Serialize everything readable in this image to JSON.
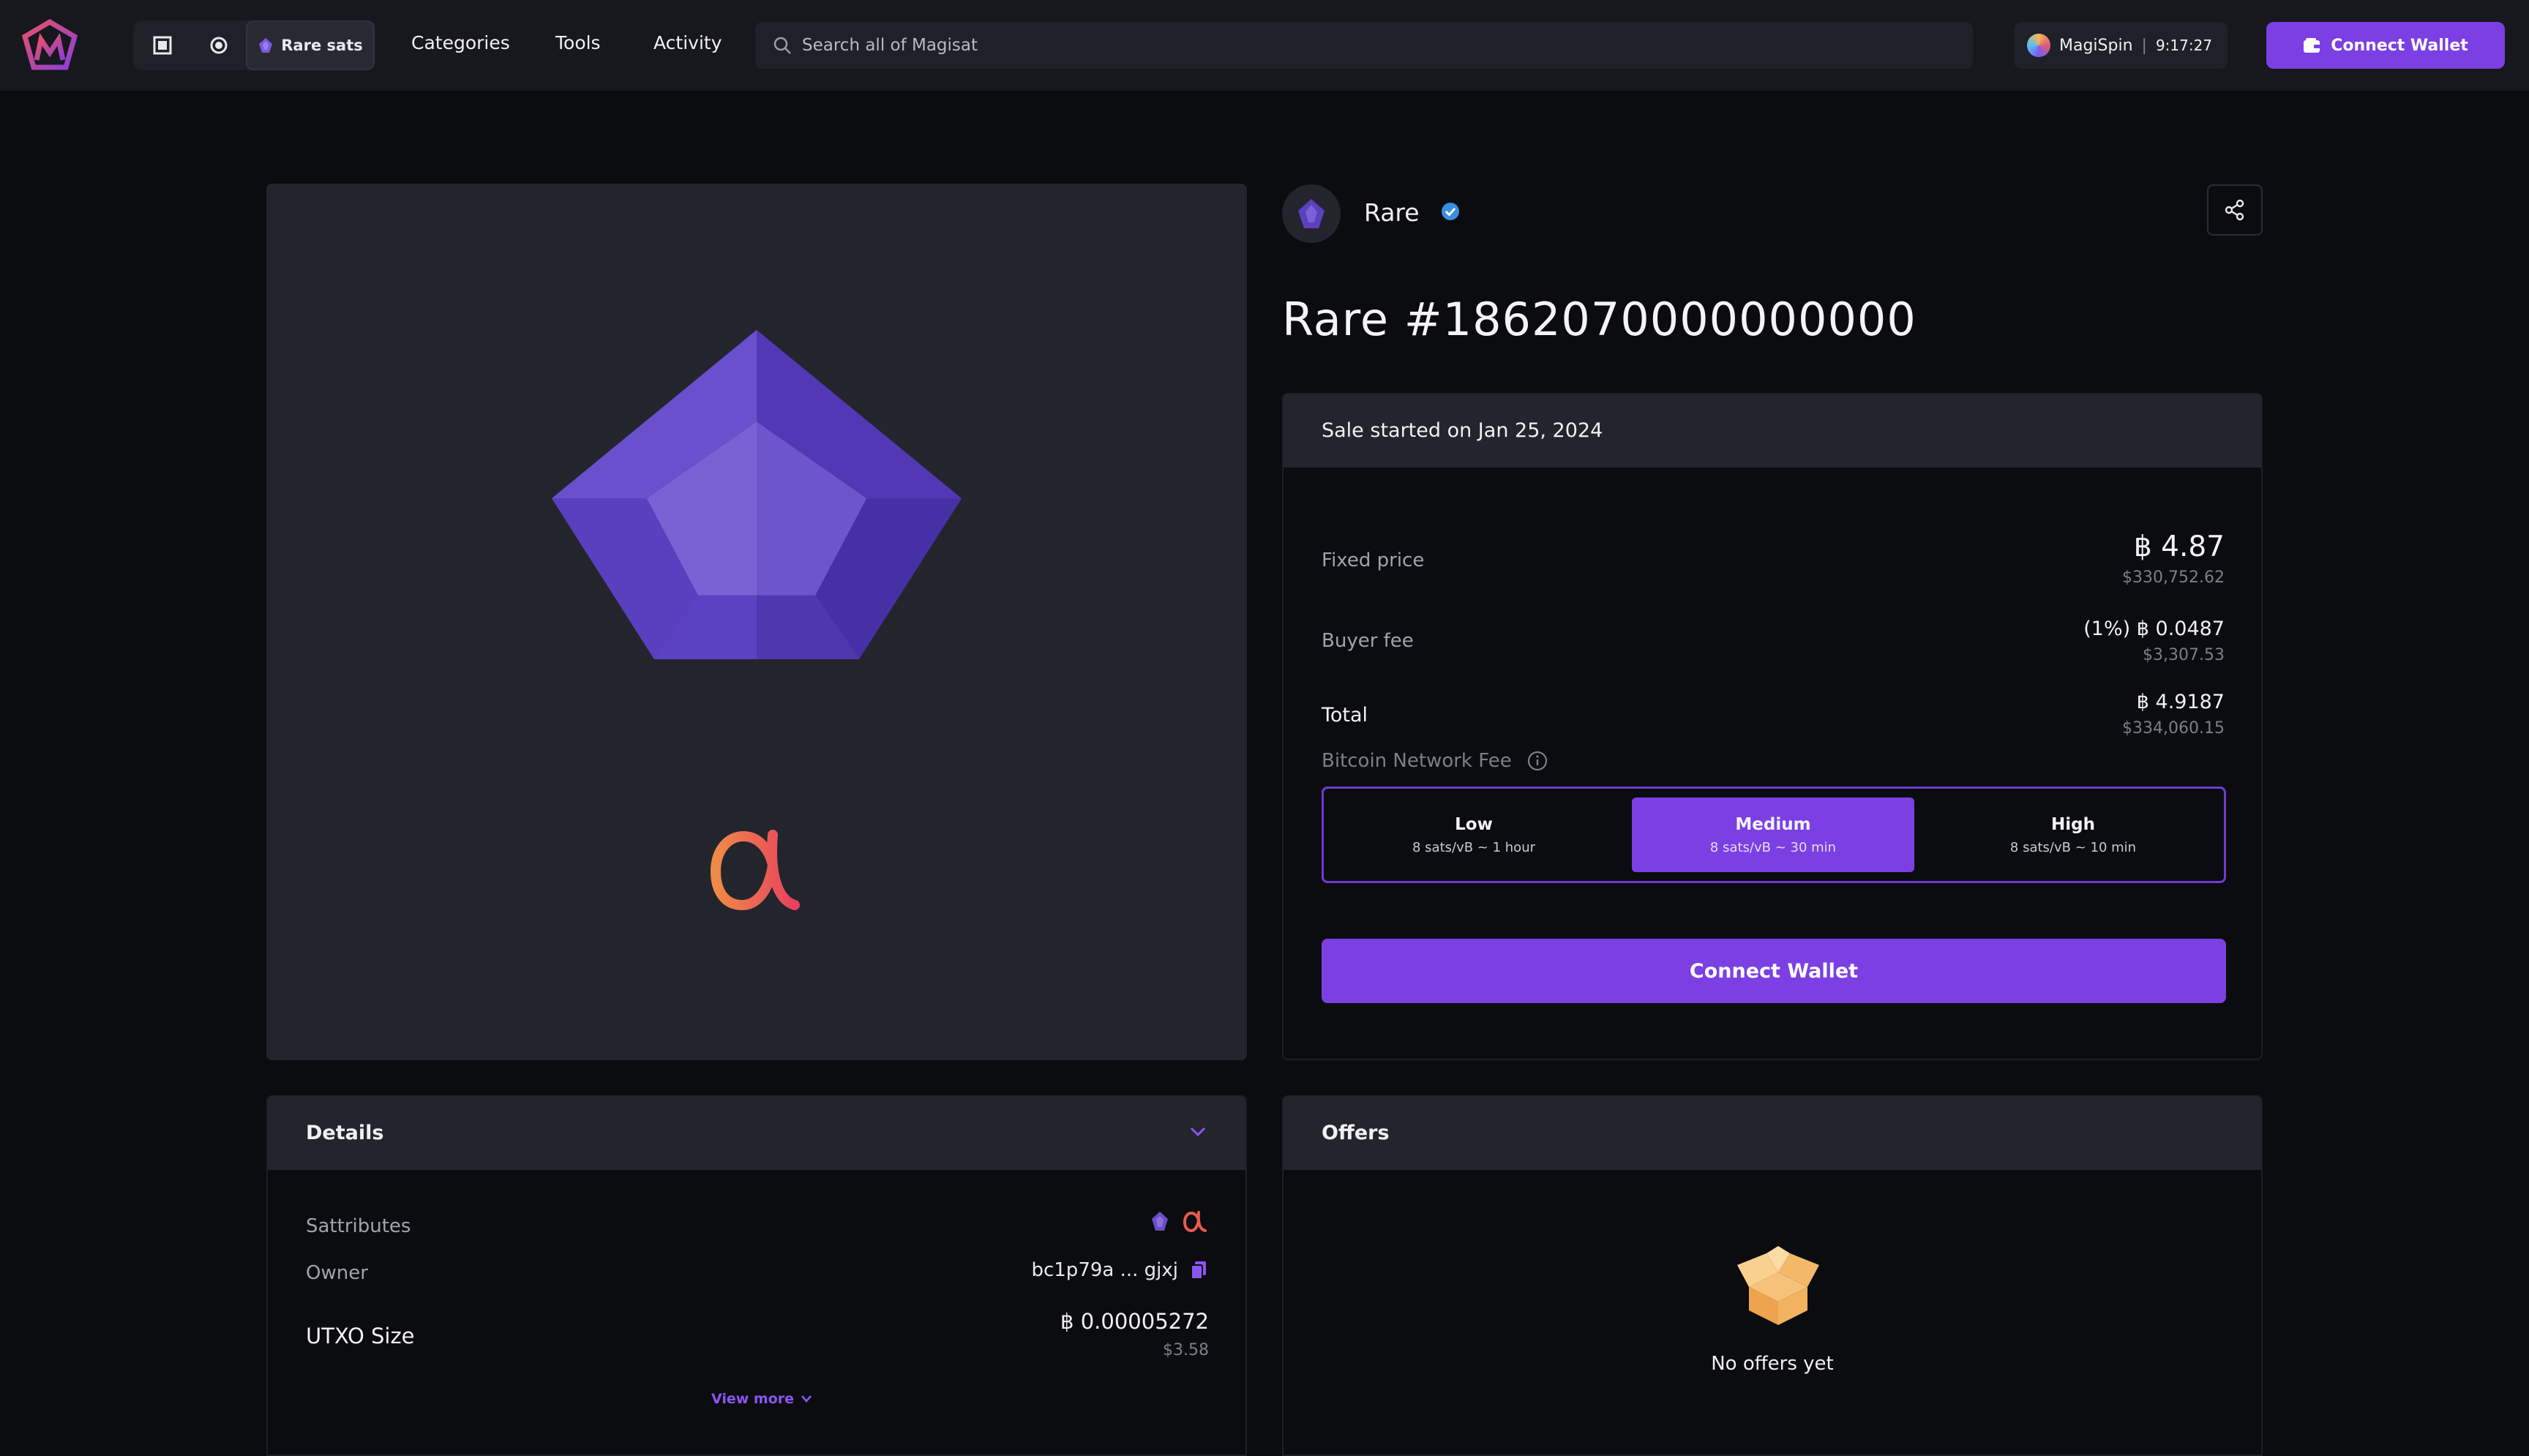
{
  "nav": {
    "mode_label": "Rare sats",
    "links": [
      "Categories",
      "Tools",
      "Activity"
    ],
    "search_placeholder": "Search all of Magisat",
    "magispin": {
      "name": "MagiSpin",
      "separator": "|",
      "timer": "9:17:27"
    },
    "connect_wallet": "Connect Wallet"
  },
  "collection": {
    "name": "Rare",
    "verified": true
  },
  "item": {
    "title": "Rare #1862070000000000"
  },
  "sale": {
    "started": "Sale started on Jan 25, 2024",
    "fixed_price_label": "Fixed price",
    "fixed_price": "4.87",
    "fixed_price_usd": "$330,752.62",
    "buyer_fee_label": "Buyer fee",
    "buyer_fee_pct": "(1%)",
    "buyer_fee": "0.0487",
    "buyer_fee_usd": "$3,307.53",
    "total_label": "Total",
    "total": "4.9187",
    "total_usd": "$334,060.15",
    "network_fee_label": "Bitcoin Network Fee",
    "fee_options": [
      {
        "name": "Low",
        "detail": "8 sats/vB ~ 1 hour"
      },
      {
        "name": "Medium",
        "detail": "8 sats/vB ~ 30 min",
        "selected": true
      },
      {
        "name": "High",
        "detail": "8 sats/vB ~ 10 min"
      }
    ],
    "connect_wallet": "Connect Wallet"
  },
  "details": {
    "title": "Details",
    "sattributes_label": "Sattributes",
    "owner_label": "Owner",
    "owner_value": "bc1p79a ... gjxj",
    "utxo_label": "UTXO Size",
    "utxo_value": "0.00005272",
    "utxo_usd": "$3.58",
    "view_more": "View more"
  },
  "offers": {
    "title": "Offers",
    "empty": "No offers yet"
  },
  "symbols": {
    "btc": "฿",
    "alpha": "α"
  },
  "colors": {
    "accent": "#7b3fe4",
    "gem": "#6a4ec8",
    "alpha": "#ea5a4e"
  }
}
